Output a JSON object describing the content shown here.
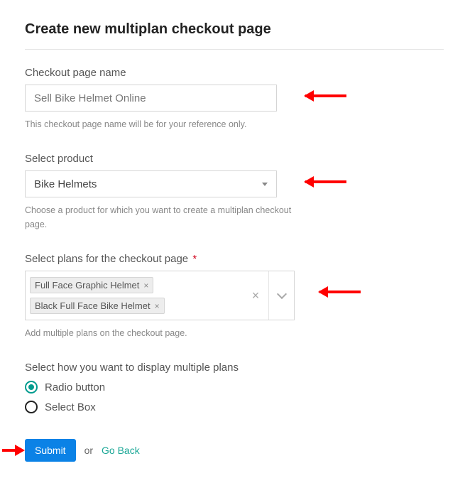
{
  "title": "Create new multiplan checkout page",
  "fields": {
    "name": {
      "label": "Checkout page name",
      "value": "Sell Bike Helmet Online",
      "helper": "This checkout page name will be for your reference only."
    },
    "product": {
      "label": "Select product",
      "value": "Bike Helmets",
      "helper": "Choose a product for which you want to create a multiplan checkout page."
    },
    "plans": {
      "label": "Select plans for the checkout page",
      "required_mark": "*",
      "tags": [
        "Full Face Graphic Helmet",
        "Black Full Face Bike Helmet"
      ],
      "helper": "Add multiple plans on the checkout page."
    },
    "display": {
      "label": "Select how you want to display multiple plans",
      "options": [
        "Radio button",
        "Select Box"
      ],
      "selected_index": 0
    }
  },
  "actions": {
    "submit": "Submit",
    "or": "or",
    "goback": "Go Back"
  }
}
